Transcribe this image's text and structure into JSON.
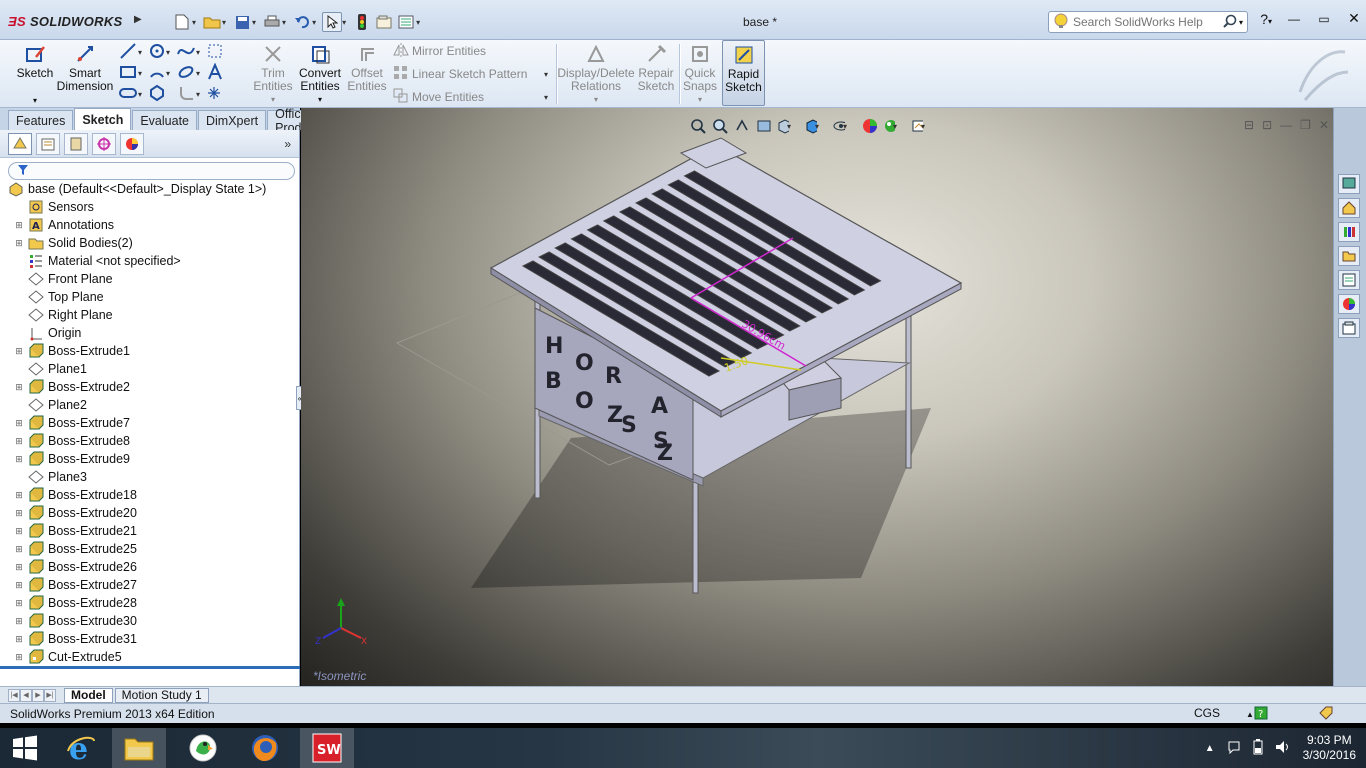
{
  "app": {
    "brand": "SOLIDWORKS",
    "doc_title": "base *"
  },
  "help": {
    "placeholder": "Search SolidWorks Help"
  },
  "ribbon": {
    "sketch": "Sketch",
    "smart_dimension": [
      "Smart",
      "Dimension"
    ],
    "trim": [
      "Trim",
      "Entities"
    ],
    "convert": [
      "Convert",
      "Entities"
    ],
    "offset": [
      "Offset",
      "Entities"
    ],
    "mirror": "Mirror Entities",
    "linear_pattern": "Linear Sketch Pattern",
    "move": "Move Entities",
    "display_delete": [
      "Display/Delete",
      "Relations"
    ],
    "repair": [
      "Repair",
      "Sketch"
    ],
    "quick_snaps": [
      "Quick",
      "Snaps"
    ],
    "rapid_sketch": [
      "Rapid",
      "Sketch"
    ]
  },
  "cm_tabs": [
    "Features",
    "Sketch",
    "Evaluate",
    "DimXpert",
    "Office Products"
  ],
  "cm_active": "Sketch",
  "tree": {
    "root": "base  (Default<<Default>_Display State 1>)",
    "items": [
      {
        "label": "Sensors",
        "icon": "sensor-icon",
        "exp": false
      },
      {
        "label": "Annotations",
        "icon": "annotation-icon",
        "exp": true
      },
      {
        "label": "Solid Bodies(2)",
        "icon": "solid-bodies-icon",
        "exp": true
      },
      {
        "label": "Material <not specified>",
        "icon": "material-icon",
        "exp": false
      },
      {
        "label": "Front Plane",
        "icon": "plane-icon",
        "exp": false
      },
      {
        "label": "Top Plane",
        "icon": "plane-icon",
        "exp": false
      },
      {
        "label": "Right Plane",
        "icon": "plane-icon",
        "exp": false
      },
      {
        "label": "Origin",
        "icon": "origin-icon",
        "exp": false
      },
      {
        "label": "Boss-Extrude1",
        "icon": "extrude-icon",
        "exp": true
      },
      {
        "label": "Plane1",
        "icon": "plane-icon",
        "exp": false
      },
      {
        "label": "Boss-Extrude2",
        "icon": "extrude-icon",
        "exp": true
      },
      {
        "label": "Plane2",
        "icon": "plane-icon",
        "exp": false
      },
      {
        "label": "Boss-Extrude7",
        "icon": "extrude-icon",
        "exp": true
      },
      {
        "label": "Boss-Extrude8",
        "icon": "extrude-icon",
        "exp": true
      },
      {
        "label": "Boss-Extrude9",
        "icon": "extrude-icon",
        "exp": true
      },
      {
        "label": "Plane3",
        "icon": "plane-icon",
        "exp": false
      },
      {
        "label": "Boss-Extrude18",
        "icon": "extrude-icon",
        "exp": true
      },
      {
        "label": "Boss-Extrude20",
        "icon": "extrude-icon",
        "exp": true
      },
      {
        "label": "Boss-Extrude21",
        "icon": "extrude-icon",
        "exp": true
      },
      {
        "label": "Boss-Extrude25",
        "icon": "extrude-icon",
        "exp": true
      },
      {
        "label": "Boss-Extrude26",
        "icon": "extrude-icon",
        "exp": true
      },
      {
        "label": "Boss-Extrude27",
        "icon": "extrude-icon",
        "exp": true
      },
      {
        "label": "Boss-Extrude28",
        "icon": "extrude-icon",
        "exp": true
      },
      {
        "label": "Boss-Extrude30",
        "icon": "extrude-icon",
        "exp": true
      },
      {
        "label": "Boss-Extrude31",
        "icon": "extrude-icon",
        "exp": true
      },
      {
        "label": "Cut-Extrude5",
        "icon": "cut-extrude-icon",
        "exp": true
      }
    ]
  },
  "model_tabs": [
    "Model",
    "Motion Study 1"
  ],
  "status": {
    "text": "SolidWorks Premium 2013 x64 Edition",
    "units": "CGS"
  },
  "viewport": {
    "view_label": "*Isometric",
    "dims": {
      "length": "30.96cm",
      "height": "1.50"
    },
    "letters": [
      "H",
      "O",
      "B",
      "A",
      "R",
      "O",
      "S",
      "S",
      "Z",
      "Z"
    ]
  },
  "clock": {
    "time": "9:03 PM",
    "date": "3/30/2016"
  }
}
